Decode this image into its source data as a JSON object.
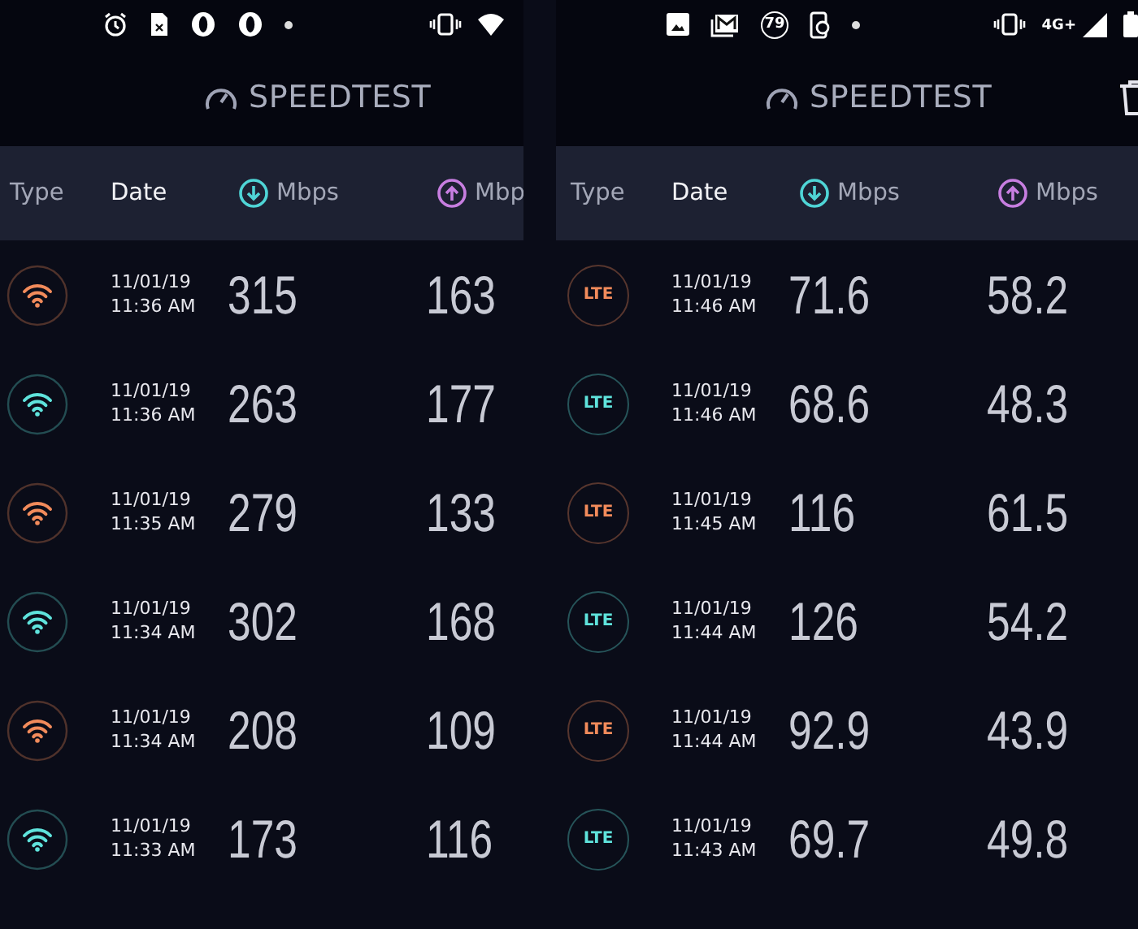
{
  "panels": [
    {
      "status_left": [
        {
          "kind": "alarm"
        },
        {
          "kind": "sim"
        },
        {
          "kind": "opera"
        },
        {
          "kind": "opera"
        },
        {
          "kind": "dot"
        }
      ],
      "status_right": [
        {
          "kind": "vibrate"
        },
        {
          "kind": "wifi"
        }
      ],
      "title": "SPEEDTEST",
      "columns": [
        {
          "kind": "type",
          "label": "Type"
        },
        {
          "kind": "date",
          "label": "Date"
        },
        {
          "kind": "download",
          "label": "Mbps"
        },
        {
          "kind": "upload",
          "label": "Mbp"
        }
      ],
      "rows": [
        {
          "kind": "wifi",
          "color": "#f28b5b",
          "date": "11/01/19",
          "time": "11:36 AM",
          "download": "315",
          "upload": "163"
        },
        {
          "kind": "wifi",
          "color": "#5fe3dc",
          "date": "11/01/19",
          "time": "11:36 AM",
          "download": "263",
          "upload": "177"
        },
        {
          "kind": "wifi",
          "color": "#f28b5b",
          "date": "11/01/19",
          "time": "11:35 AM",
          "download": "279",
          "upload": "133"
        },
        {
          "kind": "wifi",
          "color": "#5fe3dc",
          "date": "11/01/19",
          "time": "11:34 AM",
          "download": "302",
          "upload": "168"
        },
        {
          "kind": "wifi",
          "color": "#f28b5b",
          "date": "11/01/19",
          "time": "11:34 AM",
          "download": "208",
          "upload": "109"
        },
        {
          "kind": "wifi",
          "color": "#5fe3dc",
          "date": "11/01/19",
          "time": "11:33 AM",
          "download": "173",
          "upload": "116"
        }
      ]
    },
    {
      "status_left": [
        {
          "kind": "image"
        },
        {
          "kind": "mail"
        },
        {
          "kind": "badge",
          "text": "79"
        },
        {
          "kind": "phone"
        },
        {
          "kind": "dot"
        }
      ],
      "status_right": [
        {
          "kind": "vibrate"
        },
        {
          "kind": "network",
          "text": "4G+"
        },
        {
          "kind": "signal"
        },
        {
          "kind": "battery"
        }
      ],
      "title": "SPEEDTEST",
      "actions": [
        {
          "kind": "trash"
        }
      ],
      "columns": [
        {
          "kind": "type",
          "label": "Type"
        },
        {
          "kind": "date",
          "label": "Date"
        },
        {
          "kind": "download",
          "label": "Mbps"
        },
        {
          "kind": "upload",
          "label": "Mbps"
        }
      ],
      "rows": [
        {
          "kind": "lte",
          "label": "LTE",
          "color": "#f28b5b",
          "date": "11/01/19",
          "time": "11:46 AM",
          "download": "71.6",
          "upload": "58.2"
        },
        {
          "kind": "lte",
          "label": "LTE",
          "color": "#5fe3dc",
          "date": "11/01/19",
          "time": "11:46 AM",
          "download": "68.6",
          "upload": "48.3"
        },
        {
          "kind": "lte",
          "label": "LTE",
          "color": "#f28b5b",
          "date": "11/01/19",
          "time": "11:45 AM",
          "download": "116",
          "upload": "61.5"
        },
        {
          "kind": "lte",
          "label": "LTE",
          "color": "#5fe3dc",
          "date": "11/01/19",
          "time": "11:44 AM",
          "download": "126",
          "upload": "54.2"
        },
        {
          "kind": "lte",
          "label": "LTE",
          "color": "#f28b5b",
          "date": "11/01/19",
          "time": "11:44 AM",
          "download": "92.9",
          "upload": "43.9"
        },
        {
          "kind": "lte",
          "label": "LTE",
          "color": "#5fe3dc",
          "date": "11/01/19",
          "time": "11:43 AM",
          "download": "69.7",
          "upload": "49.8"
        }
      ]
    }
  ]
}
